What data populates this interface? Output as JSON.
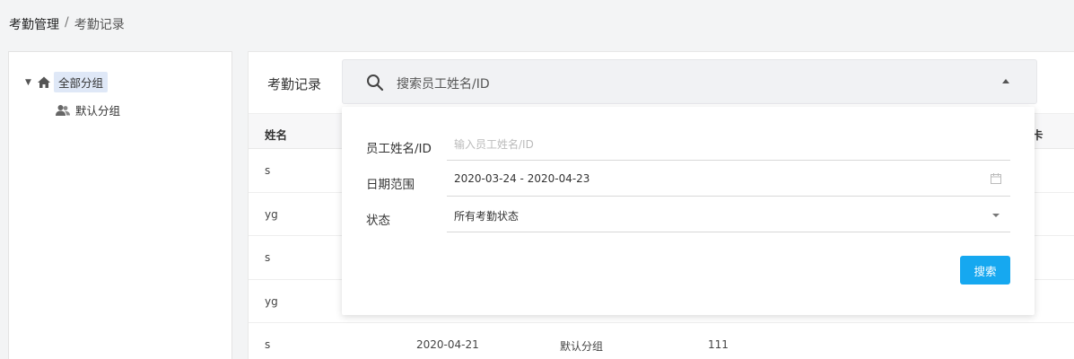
{
  "breadcrumb": {
    "root": "考勤管理",
    "separator": "/",
    "current": "考勤记录"
  },
  "tree": {
    "root_label": "全部分组",
    "children": [
      {
        "label": "默认分组"
      }
    ]
  },
  "main": {
    "title": "考勤记录",
    "search": {
      "placeholder": "搜索员工姓名/ID"
    },
    "table": {
      "columns": {
        "name": "姓名",
        "right_partial": "卡"
      },
      "rows": [
        {
          "name": "s",
          "date": "",
          "group": "",
          "value": ""
        },
        {
          "name": "yg",
          "date": "",
          "group": "",
          "value": ""
        },
        {
          "name": "s",
          "date": "",
          "group": "",
          "value": ""
        },
        {
          "name": "yg",
          "date": "",
          "group": "",
          "value": ""
        },
        {
          "name": "s",
          "date": "2020-04-21",
          "group": "默认分组",
          "value": "111"
        }
      ]
    }
  },
  "filter": {
    "employee_label": "员工姓名/ID",
    "employee_placeholder": "输入员工姓名/ID",
    "date_label": "日期范围",
    "date_value": "2020-03-24 - 2020-04-23",
    "status_label": "状态",
    "status_value": "所有考勤状态",
    "search_button": "搜索"
  },
  "colors": {
    "accent": "#16a8f0",
    "tree_selected_bg": "#dfe8f7"
  }
}
